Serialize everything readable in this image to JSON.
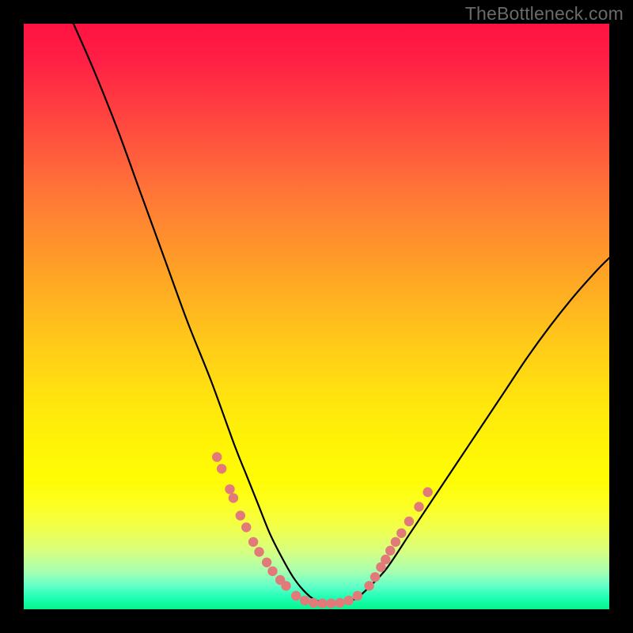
{
  "watermark": "TheBottleneck.com",
  "colors": {
    "curve": "#000000",
    "dots": "#e27a7a",
    "background": "#000000"
  },
  "chart_data": {
    "type": "line",
    "title": "",
    "xlabel": "",
    "ylabel": "",
    "xlim": [
      0,
      100
    ],
    "ylim": [
      0,
      100
    ],
    "grid": false,
    "legend": false,
    "series": [
      {
        "name": "curve",
        "style": "line",
        "color": "#000000",
        "x": [
          8.5,
          12,
          16,
          20,
          24,
          28,
          32,
          36,
          38,
          40,
          42,
          44,
          46,
          48,
          50,
          53,
          55,
          57,
          59,
          62,
          66,
          70,
          74,
          78,
          82,
          86,
          90,
          94,
          98,
          100
        ],
        "y": [
          100,
          92,
          82,
          71,
          60,
          49,
          39,
          28,
          23,
          18,
          13,
          9,
          5.5,
          3,
          1.5,
          1,
          1.2,
          2,
          3.8,
          7,
          13,
          19,
          25,
          31,
          37,
          43,
          48.5,
          53.5,
          58,
          60
        ]
      },
      {
        "name": "left-dots",
        "style": "scatter",
        "color": "#e27a7a",
        "x": [
          33.0,
          33.8,
          35.2,
          35.8,
          37.0,
          38.0,
          39.2,
          40.2,
          41.5,
          42.5,
          43.8,
          44.8
        ],
        "y": [
          26.0,
          24.0,
          20.5,
          19.0,
          16.0,
          14.0,
          11.5,
          9.8,
          8.0,
          6.5,
          5.0,
          4.0
        ]
      },
      {
        "name": "right-dots",
        "style": "scatter",
        "color": "#e27a7a",
        "x": [
          59.0,
          60.0,
          61.0,
          61.8,
          62.6,
          63.5,
          64.5,
          65.8,
          67.5,
          69.0
        ],
        "y": [
          4.0,
          5.5,
          7.2,
          8.5,
          10.0,
          11.5,
          13.0,
          15.0,
          17.5,
          20.0
        ]
      },
      {
        "name": "bottom-dots",
        "style": "scatter",
        "color": "#e27a7a",
        "x": [
          46.5,
          48.0,
          49.5,
          51.0,
          52.5,
          54.0,
          55.5,
          57.0
        ],
        "y": [
          2.3,
          1.5,
          1.1,
          1.0,
          1.0,
          1.1,
          1.5,
          2.3
        ]
      }
    ]
  }
}
